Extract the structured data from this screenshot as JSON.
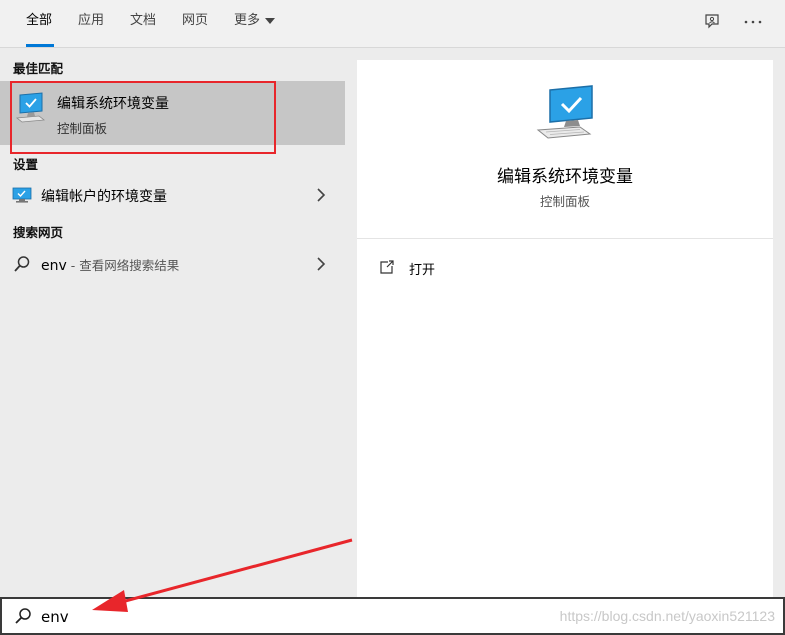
{
  "tabs": [
    {
      "label": "全部",
      "active": true
    },
    {
      "label": "应用",
      "active": false
    },
    {
      "label": "文档",
      "active": false
    },
    {
      "label": "网页",
      "active": false
    },
    {
      "label": "更多",
      "active": false
    }
  ],
  "toolbar": {
    "feedback_icon": "feedback-icon",
    "more_icon": "more-options-icon"
  },
  "left": {
    "best_match_heading": "最佳匹配",
    "best_match": {
      "title": "编辑系统环境变量",
      "subtitle": "控制面板",
      "icon": "monitor-check-icon"
    },
    "settings_heading": "设置",
    "settings_items": [
      {
        "label": "编辑帐户的环境变量",
        "icon": "monitor-icon"
      }
    ],
    "web_heading": "搜索网页",
    "web_items": [
      {
        "query": "env",
        "suffix": " - 查看网络搜索结果",
        "icon": "search-icon"
      }
    ]
  },
  "preview": {
    "title": "编辑系统环境变量",
    "subtitle": "控制面板",
    "actions": [
      {
        "label": "打开",
        "icon": "open-icon"
      }
    ]
  },
  "search": {
    "value": "env"
  },
  "watermark": "https://blog.csdn.net/yaoxin521123",
  "colors": {
    "accent": "#0078d7",
    "highlight_outline": "#e8262b",
    "selected_row": "#c6c6c6"
  }
}
